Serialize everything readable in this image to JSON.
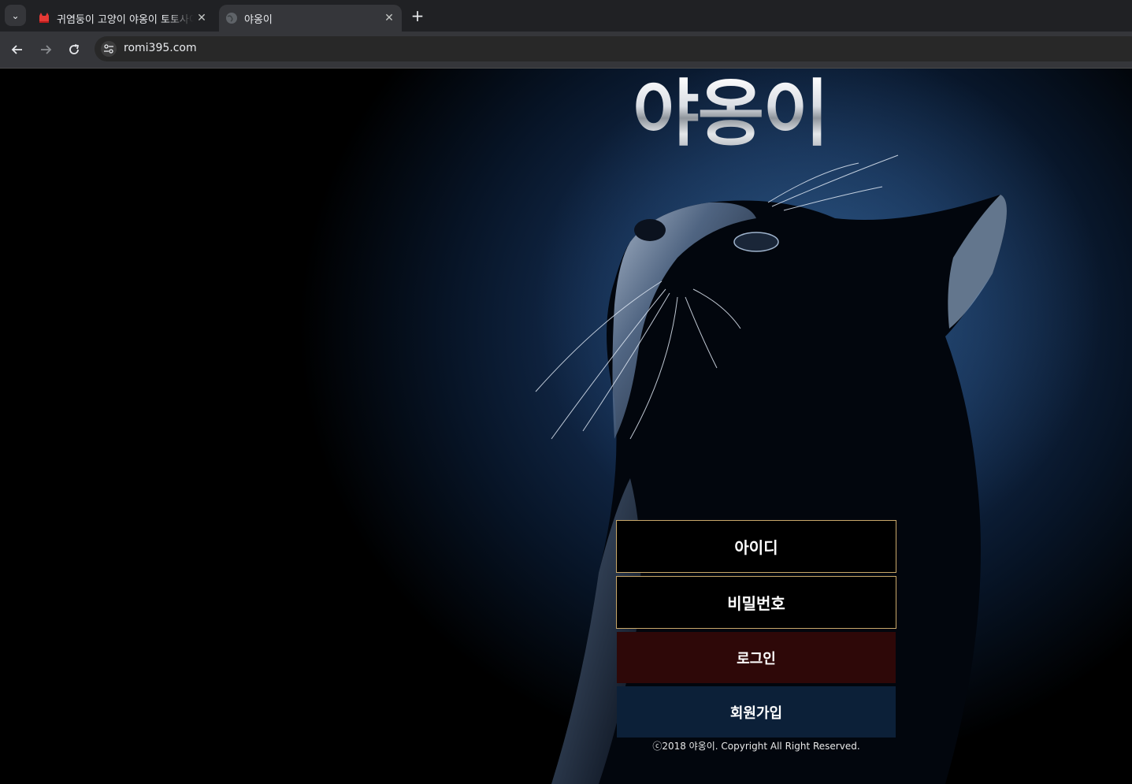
{
  "browser": {
    "tabs": [
      {
        "title": "귀염둥이 고양이 야옹이 토토사이트",
        "icon": "red-cat-favicon",
        "close": "✕"
      },
      {
        "title": "야옹이",
        "icon": "globe-icon",
        "close": "✕"
      }
    ],
    "tab_menu": "⌄",
    "new_tab": "+",
    "url": "romi395.com"
  },
  "page": {
    "logo": "야옹이",
    "id_placeholder": "아이디",
    "password_placeholder": "비밀번호",
    "login_label": "로그인",
    "signup_label": "회원가입",
    "copyright": "ⓒ2018 야옹이. Copyright All Right Reserved."
  },
  "colors": {
    "field_border": "#c9a86a",
    "login_bg": "#2e0808",
    "signup_bg": "#0c2038"
  }
}
